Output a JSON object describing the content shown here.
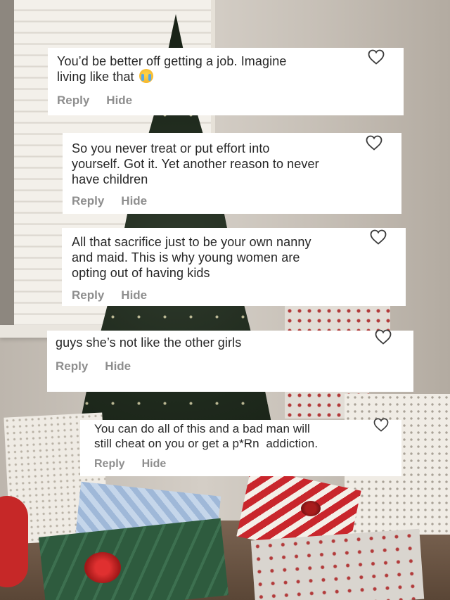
{
  "comments": [
    {
      "text_line1": "You’d be better off getting a job. Imagine",
      "text_line2": "living like that",
      "emoji_icon": "loudly-crying-face-emoji",
      "reply_label": "Reply",
      "hide_label": "Hide",
      "like_icon": "heart-outline-icon"
    },
    {
      "text": "So you never treat or put effort into\nyourself. Got it. Yet another reason to never\nhave children",
      "reply_label": "Reply",
      "hide_label": "Hide",
      "like_icon": "heart-outline-icon"
    },
    {
      "text": "All that sacrifice just to be your own nanny\nand maid. This is why young women are\nopting out of having kids",
      "reply_label": "Reply",
      "hide_label": "Hide",
      "like_icon": "heart-outline-icon"
    },
    {
      "text": "guys she’s not like the other girls",
      "reply_label": "Reply",
      "hide_label": "Hide",
      "like_icon": "heart-outline-icon"
    },
    {
      "text": "You can do all of this and a bad man will\nstill cheat on you or get a p*Rn  addiction.",
      "reply_label": "Reply",
      "hide_label": "Hide",
      "like_icon": "heart-outline-icon"
    }
  ],
  "colors": {
    "card_bg": "#ffffff",
    "text": "#262626",
    "action_text": "#8e8e8e"
  }
}
